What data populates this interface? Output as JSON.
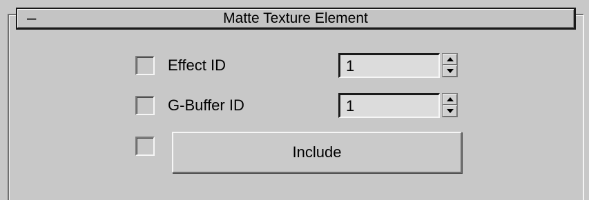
{
  "rollout": {
    "title": "Matte Texture Element",
    "collapse_glyph": "–",
    "collapse_icon": "collapse-minus-icon"
  },
  "effect_id": {
    "label": "Effect ID",
    "checked": false,
    "value": "1"
  },
  "gbuffer_id": {
    "label": "G-Buffer ID",
    "checked": false,
    "value": "1"
  },
  "include": {
    "checked": false,
    "button_label": "Include"
  },
  "spinner_icons": {
    "up": "spinner-up-arrow-icon",
    "down": "spinner-down-arrow-icon"
  },
  "colors": {
    "panel_bg": "#c8c8c8",
    "field_bg": "#dcdcdc",
    "header_border": "#1a1a1a"
  }
}
